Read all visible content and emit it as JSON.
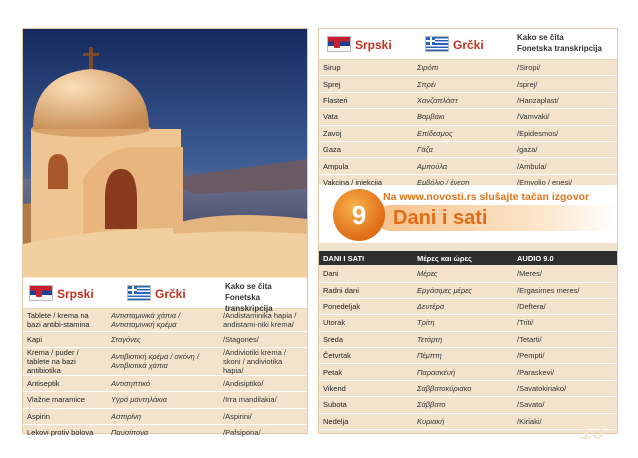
{
  "page_number": "13",
  "lang": {
    "serbian": "Srpski",
    "greek": "Grčki",
    "kako": "Kako se čita",
    "fonetska": "Fonetska transkripcija"
  },
  "left_table": [
    {
      "sr": "Tablete / krema na bazi antibi-stamina",
      "gr": "Αντισταμινικά χάπια / Αντισταμινική κρέμα",
      "tr": "/Andistaminika hapia / andistami-niki krema/"
    },
    {
      "sr": "Kapi",
      "gr": "Σταγόνες",
      "tr": "/Stagones/"
    },
    {
      "sr": "Krema / puder / tablete na bazi antibiotika",
      "gr": "Αντιβιοτική κρέμα / σκόνη / Αντιβιοτικά χάπια",
      "tr": "/Andiviotiki krema / skoni / andiviotika hapia/"
    },
    {
      "sr": "Antiseptik",
      "gr": "Αντισηπτικό",
      "tr": "/Andisiptiko/"
    },
    {
      "sr": "Vlažne maramice",
      "gr": "Υγρά μαντηλάκια",
      "tr": "/Ігга mandilakia/"
    },
    {
      "sr": "Aspirin",
      "gr": "Ασπιρίνη",
      "tr": "/Aspirini/"
    },
    {
      "sr": "Lekovi protiv bolova",
      "gr": "Παυσίπονα",
      "tr": "/Pafsipona/"
    }
  ],
  "right_table": [
    {
      "sr": "Sirup",
      "gr": "Σιρόπι",
      "tr": "/Siropi/"
    },
    {
      "sr": "Sprej",
      "gr": "Σπρέι",
      "tr": "/sprej/"
    },
    {
      "sr": "Flasteri",
      "gr": "Χανζαπλάστ",
      "tr": "/Hanzaplast/"
    },
    {
      "sr": "Vata",
      "gr": "Βαμβάκι",
      "tr": "/Vamvaki/"
    },
    {
      "sr": "Zavoj",
      "gr": "Επίδεσμος",
      "tr": "/Epidesmos/"
    },
    {
      "sr": "Gaza",
      "gr": "Γάζα",
      "tr": "/gaza/"
    },
    {
      "sr": "Ampula",
      "gr": "Αμπούλα",
      "tr": "/Ambula/"
    },
    {
      "sr": "Vakcina / injekcija",
      "gr": "Εμβόλιο / ένεση",
      "tr": "/Emvolio / enesi/"
    }
  ],
  "banner": {
    "number": "9",
    "site_text": "Na www.novosti.rs slušajte tačan izgovor",
    "title": "Dani i sati"
  },
  "days_header": {
    "col1": "DANI I SATI",
    "col2": "Μέρες και ώρες",
    "col3": "AUDIO 9.0"
  },
  "days_table": [
    {
      "sr": "Dani",
      "gr": "Μέρες",
      "tr": "/Meres/"
    },
    {
      "sr": "Radni dani",
      "gr": "Εργάσιμες μέρες",
      "tr": "/Ergasimes meres/"
    },
    {
      "sr": "Ponedeljak",
      "gr": "Δευτέρα",
      "tr": "/Deftera/"
    },
    {
      "sr": "Utorak",
      "gr": "Τρίτη",
      "tr": "/Triti/"
    },
    {
      "sr": "Sreda",
      "gr": "Τετάρτη",
      "tr": "/Tetarti/"
    },
    {
      "sr": "Četvrtak",
      "gr": "Πέμπτη",
      "tr": "/Pempti/"
    },
    {
      "sr": "Petak",
      "gr": "Παρασκευή",
      "tr": "/Paraskevi/"
    },
    {
      "sr": "Vikend",
      "gr": "Σαββατοκύριακο",
      "tr": "/Savatokiriako/"
    },
    {
      "sr": "Subota",
      "gr": "Σάββατο",
      "tr": "/Savato/"
    },
    {
      "sr": "Nedelja",
      "gr": "Κυριακή",
      "tr": "/Kiriaki/"
    }
  ]
}
